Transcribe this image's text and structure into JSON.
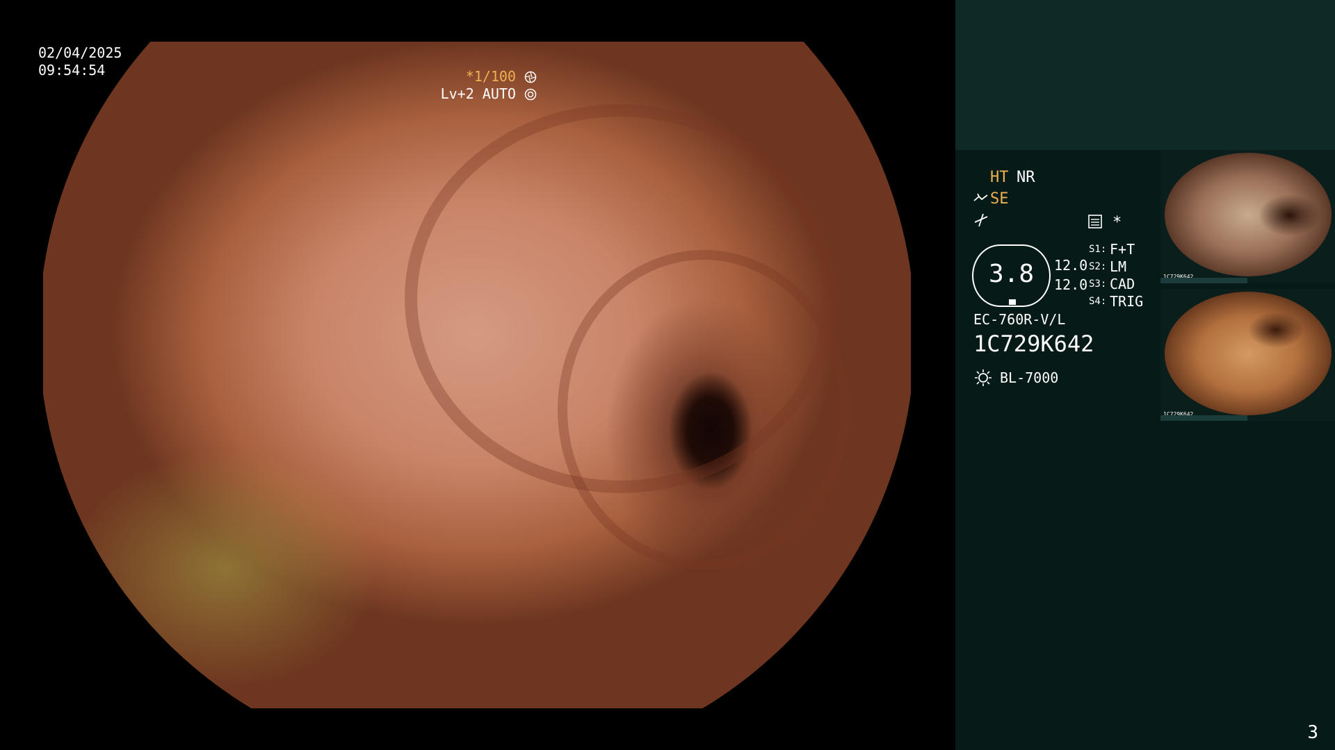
{
  "viewer": {
    "date": "02/04/2025",
    "time": "09:54:54",
    "shutter": "*1/100",
    "level": "Lv+2 AUTO"
  },
  "status": {
    "ht": "HT",
    "nr": "NR",
    "se": "SE",
    "value_badge": "3.8",
    "val_a": "12.0",
    "val_b": "12.0",
    "s1_key": "S1:",
    "s1_val": "F+T",
    "s2_key": "S2:",
    "s2_val": "LM",
    "s3_key": "S3:",
    "s3_val": "CAD",
    "s4_key": "S4:",
    "s4_val": "TRIG",
    "scope_model": "EC-760R-V/L",
    "serial": "1C729K642",
    "light_source": "BL-7000",
    "star": "*"
  },
  "thumbnails": {
    "thumb1_serial": "1C729K642",
    "thumb2_serial": "1C729K642"
  },
  "page": {
    "number": "3"
  },
  "colors": {
    "accent_orange": "#f0b050",
    "panel_bg": "#061b18",
    "panel_top_bg": "#0e2a26"
  },
  "icons": [
    "shutter-icon",
    "auto-icon",
    "scope-icon",
    "enhance-icon",
    "settings-icon",
    "light-icon"
  ]
}
